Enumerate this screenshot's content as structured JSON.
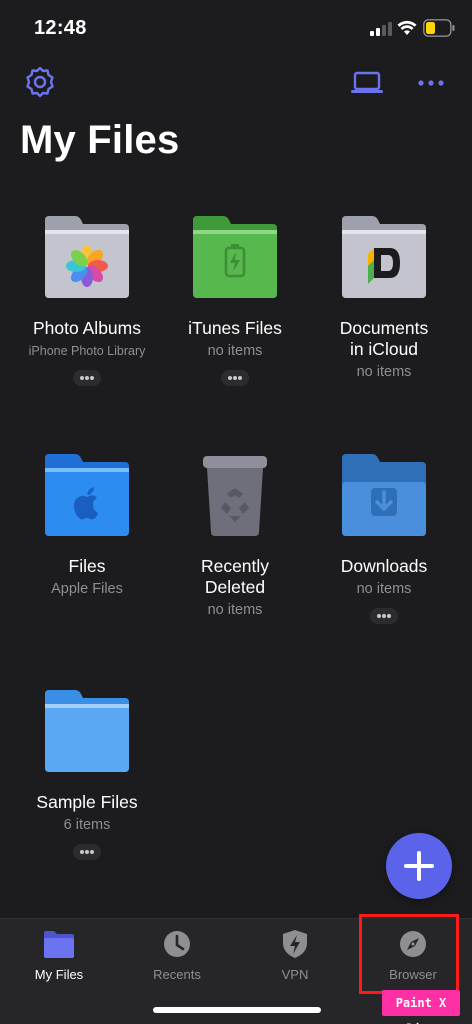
{
  "status_bar": {
    "time": "12:48"
  },
  "header": {
    "title": "My Files"
  },
  "items": [
    {
      "name": "Photo Albums",
      "sub": "iPhone Photo Library",
      "has_more": true
    },
    {
      "name": "iTunes Files",
      "sub": "no items",
      "has_more": true
    },
    {
      "name_line1": "Documents",
      "name_line2": "in iCloud",
      "sub": "no items",
      "has_more": false
    },
    {
      "name": "Files",
      "sub": "Apple Files",
      "has_more": false
    },
    {
      "name_line1": "Recently",
      "name_line2": "Deleted",
      "sub": "no items",
      "has_more": false
    },
    {
      "name": "Downloads",
      "sub": "no items",
      "has_more": true
    },
    {
      "name": "Sample Files",
      "sub": "6 items",
      "has_more": true
    }
  ],
  "tabs": [
    {
      "label": "My Files",
      "icon": "folder-icon",
      "active": true
    },
    {
      "label": "Recents",
      "icon": "clock-icon",
      "active": false
    },
    {
      "label": "VPN",
      "icon": "shield-bolt-icon",
      "active": false
    },
    {
      "label": "Browser",
      "icon": "compass-icon",
      "active": false
    }
  ],
  "watermark": "Paint X lite",
  "colors": {
    "background": "#1c1c1e",
    "accent": "#5b63ea",
    "tab_bar": "#262628",
    "highlight": "#ff1a1a"
  }
}
